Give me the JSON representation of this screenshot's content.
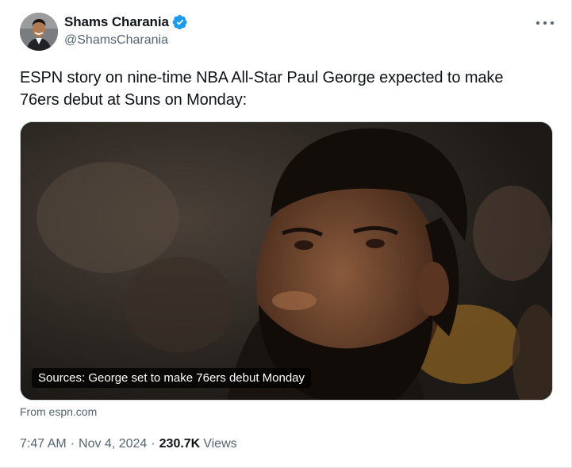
{
  "author": {
    "display_name": "Shams Charania",
    "handle": "@ShamsCharania",
    "verified": true
  },
  "tweet": {
    "text": "ESPN story on nine-time NBA All-Star Paul George expected to make 76ers debut at Suns on Monday:"
  },
  "card": {
    "title": "Sources: George set to make 76ers debut Monday",
    "source": "From espn.com"
  },
  "meta": {
    "time": "7:47 AM",
    "separator": "·",
    "date": "Nov 4, 2024",
    "views_count": "230.7K",
    "views_label": "Views"
  },
  "icons": {
    "verified": "verified-badge-icon",
    "more": "more-options-icon"
  },
  "colors": {
    "verified_blue": "#1d9bf0",
    "secondary_text": "#536471",
    "primary_text": "#0f1419"
  }
}
